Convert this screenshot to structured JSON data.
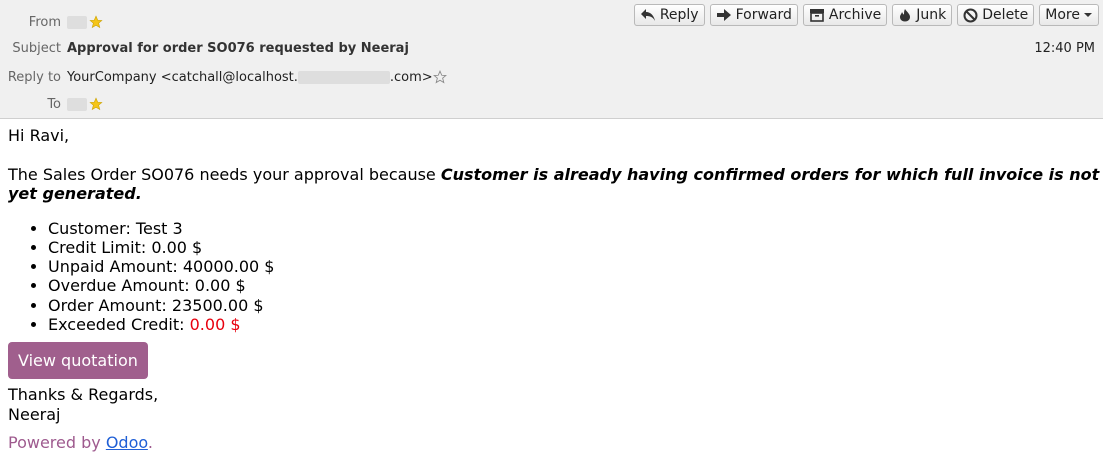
{
  "header": {
    "from_label": "From",
    "subject_label": "Subject",
    "subject": "Approval for order SO076 requested by Neeraj",
    "reply_to_label": "Reply to",
    "reply_to_prefix": "YourCompany <catchall@localhost.",
    "reply_to_suffix": ".com>",
    "to_label": "To",
    "time": "12:40 PM"
  },
  "toolbar": {
    "reply": "Reply",
    "forward": "Forward",
    "archive": "Archive",
    "junk": "Junk",
    "delete": "Delete",
    "more": "More"
  },
  "body": {
    "greeting": "Hi Ravi,",
    "intro": "The Sales Order SO076 needs your approval because ",
    "reason": "Customer is already having confirmed orders for which full invoice is not yet generated.",
    "items": [
      "Customer: Test 3",
      "Credit Limit: 0.00 $",
      "Unpaid Amount: 40000.00 $",
      "Overdue Amount: 0.00 $",
      "Order Amount: 23500.00 $"
    ],
    "exceeded_label": "Exceeded Credit: ",
    "exceeded_value": "0.00 $",
    "button": "View quotation",
    "regards": "Thanks & Regards,",
    "signature": "Neeraj",
    "powered_by": "Powered by ",
    "odoo": "Odoo",
    "period": "."
  },
  "colors": {
    "accent": "#a05f8d",
    "exceeded": "#e8000e",
    "link": "#1f5fd6"
  }
}
